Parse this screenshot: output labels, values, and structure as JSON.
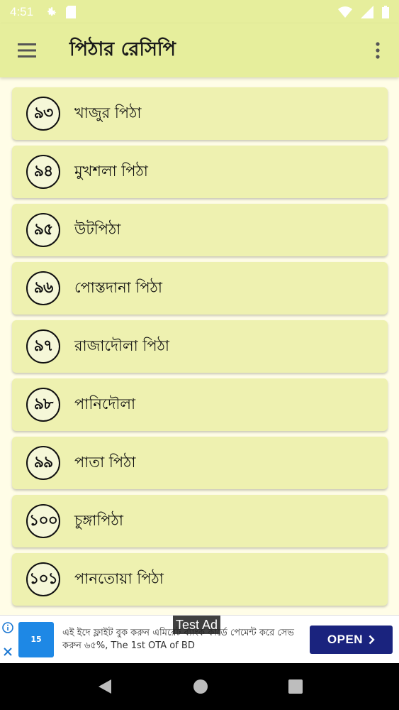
{
  "status_bar": {
    "time": "4:51"
  },
  "app_bar": {
    "title": "পিঠার রেসিপি"
  },
  "recipes": [
    {
      "number": "৯৩",
      "name": "খাজুর পিঠা"
    },
    {
      "number": "৯৪",
      "name": "মুখশলা পিঠা"
    },
    {
      "number": "৯৫",
      "name": "উটপিঠা"
    },
    {
      "number": "৯৬",
      "name": "পোস্তদানা পিঠা"
    },
    {
      "number": "৯৭",
      "name": "রাজাদৌলা পিঠা"
    },
    {
      "number": "৯৮",
      "name": "পানিদৌলা"
    },
    {
      "number": "৯৯",
      "name": "পাতা পিঠা"
    },
    {
      "number": "১০০",
      "name": "চুঙ্গাপিঠা"
    },
    {
      "number": "১০১",
      "name": "পানতোয়া পিঠা"
    }
  ],
  "ad": {
    "label": "Test Ad",
    "text": "এই ইদে ফ্লাইট বুক করুন এমিরেট ব্যাংক কার্ডে পেমেন্ট করে সেভ করুন ৬৫%, The 1st OTA of BD",
    "thumb_text": "15",
    "cta": "OPEN"
  },
  "colors": {
    "app_bar": "#e6ee9c",
    "card": "#eef1b0",
    "background": "#fffde7",
    "ad_button": "#1a237e"
  }
}
